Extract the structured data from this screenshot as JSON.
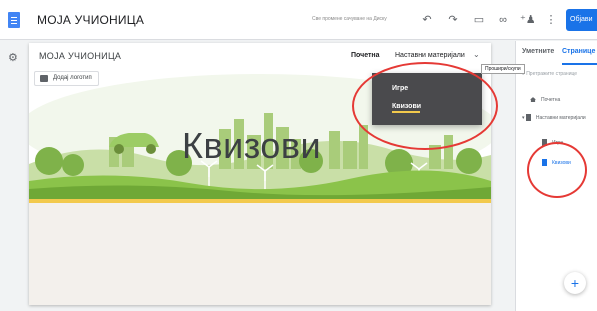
{
  "app": {
    "title": "МОЈА УЧИОНИЦА",
    "save_status": "Све промене сачуване на Диску",
    "publish_label": "Објави"
  },
  "toolbar": {
    "icons": [
      "doc-icon",
      "undo-icon",
      "redo-icon",
      "preview-icon",
      "link-icon",
      "add-person-icon",
      "more-vert-icon"
    ]
  },
  "site": {
    "name": "МОЈА УЧИОНИЦА",
    "nav": {
      "home": "Почетна",
      "materials": "Наставни материјали"
    },
    "logo_button": "Додај логотип",
    "banner_title": "Квизови",
    "expand_tooltip": "Прошири/скупи",
    "dropdown": [
      "Игре",
      "Квизови"
    ]
  },
  "panel": {
    "tabs": [
      "Уметните",
      "Странице"
    ],
    "search_placeholder": "Претражите странице",
    "tree": {
      "home": "Почетна",
      "materials": "Наставни материјали",
      "children": [
        "Игре",
        "Квизови"
      ]
    }
  },
  "colors": {
    "accent": "#1a73e8",
    "highlight": "#f2c94c",
    "annotation": "#e53935",
    "dropdown_bg": "#4a4a4d"
  }
}
